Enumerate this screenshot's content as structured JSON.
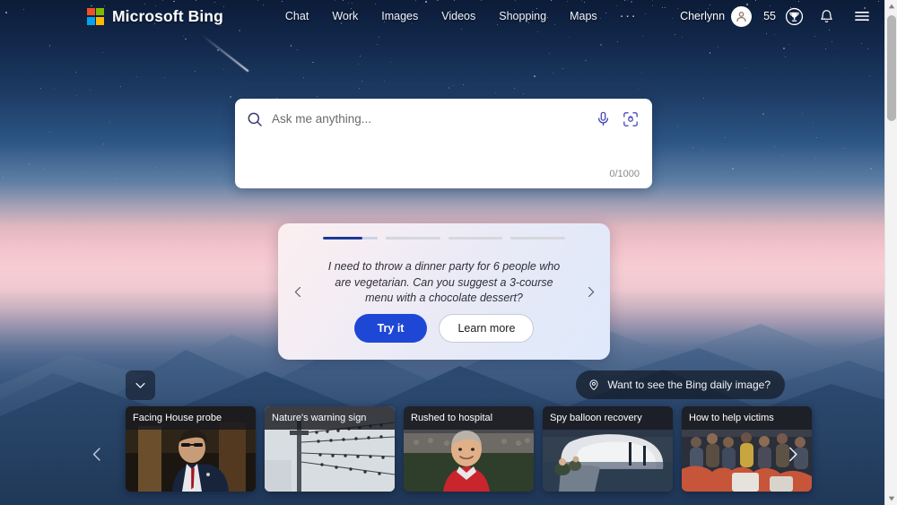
{
  "header": {
    "brand": "Microsoft Bing",
    "logo_colors": [
      "#f25022",
      "#7fba00",
      "#00a4ef",
      "#ffb900"
    ],
    "nav": [
      {
        "label": "Chat",
        "name": "nav-chat"
      },
      {
        "label": "Work",
        "name": "nav-work"
      },
      {
        "label": "Images",
        "name": "nav-images"
      },
      {
        "label": "Videos",
        "name": "nav-videos"
      },
      {
        "label": "Shopping",
        "name": "nav-shopping"
      },
      {
        "label": "Maps",
        "name": "nav-maps"
      }
    ],
    "more_label": "···",
    "user_name": "Cherlynn",
    "points": "55",
    "icons": {
      "avatar": "person-avatar-icon",
      "rewards": "trophy-icon",
      "notifications": "bell-icon",
      "menu": "hamburger-menu-icon"
    }
  },
  "search": {
    "placeholder": "Ask me anything...",
    "value": "",
    "char_count": "0/1000",
    "icons": {
      "search": "search-icon",
      "mic": "microphone-icon",
      "lens": "visual-search-icon"
    },
    "accent": "#4a4ab8"
  },
  "suggestion": {
    "text": "I need to throw a dinner party for 6 people who are vegetarian. Can you suggest a 3-course menu with a chocolate dessert?",
    "try_label": "Try it",
    "learn_label": "Learn more",
    "progress_total": 4,
    "progress_active_index": 0,
    "progress_active_fill": "72%",
    "active_color": "#1b3a96",
    "try_color": "#1f47d6"
  },
  "daily_image": {
    "label": "Want to see the Bing daily image?",
    "icon": "map-pin-icon"
  },
  "collapse": {
    "icon": "chevron-down-icon"
  },
  "carousel": {
    "prev_icon": "chevron-left-icon",
    "next_icon": "chevron-right-icon",
    "cards": [
      {
        "title": "Facing House probe"
      },
      {
        "title": "Nature's warning sign"
      },
      {
        "title": "Rushed to hospital"
      },
      {
        "title": "Spy balloon recovery"
      },
      {
        "title": "How to help victims"
      }
    ]
  },
  "scrollbar": {
    "up_icon": "scroll-up-arrow-icon",
    "down_icon": "scroll-down-arrow-icon"
  }
}
